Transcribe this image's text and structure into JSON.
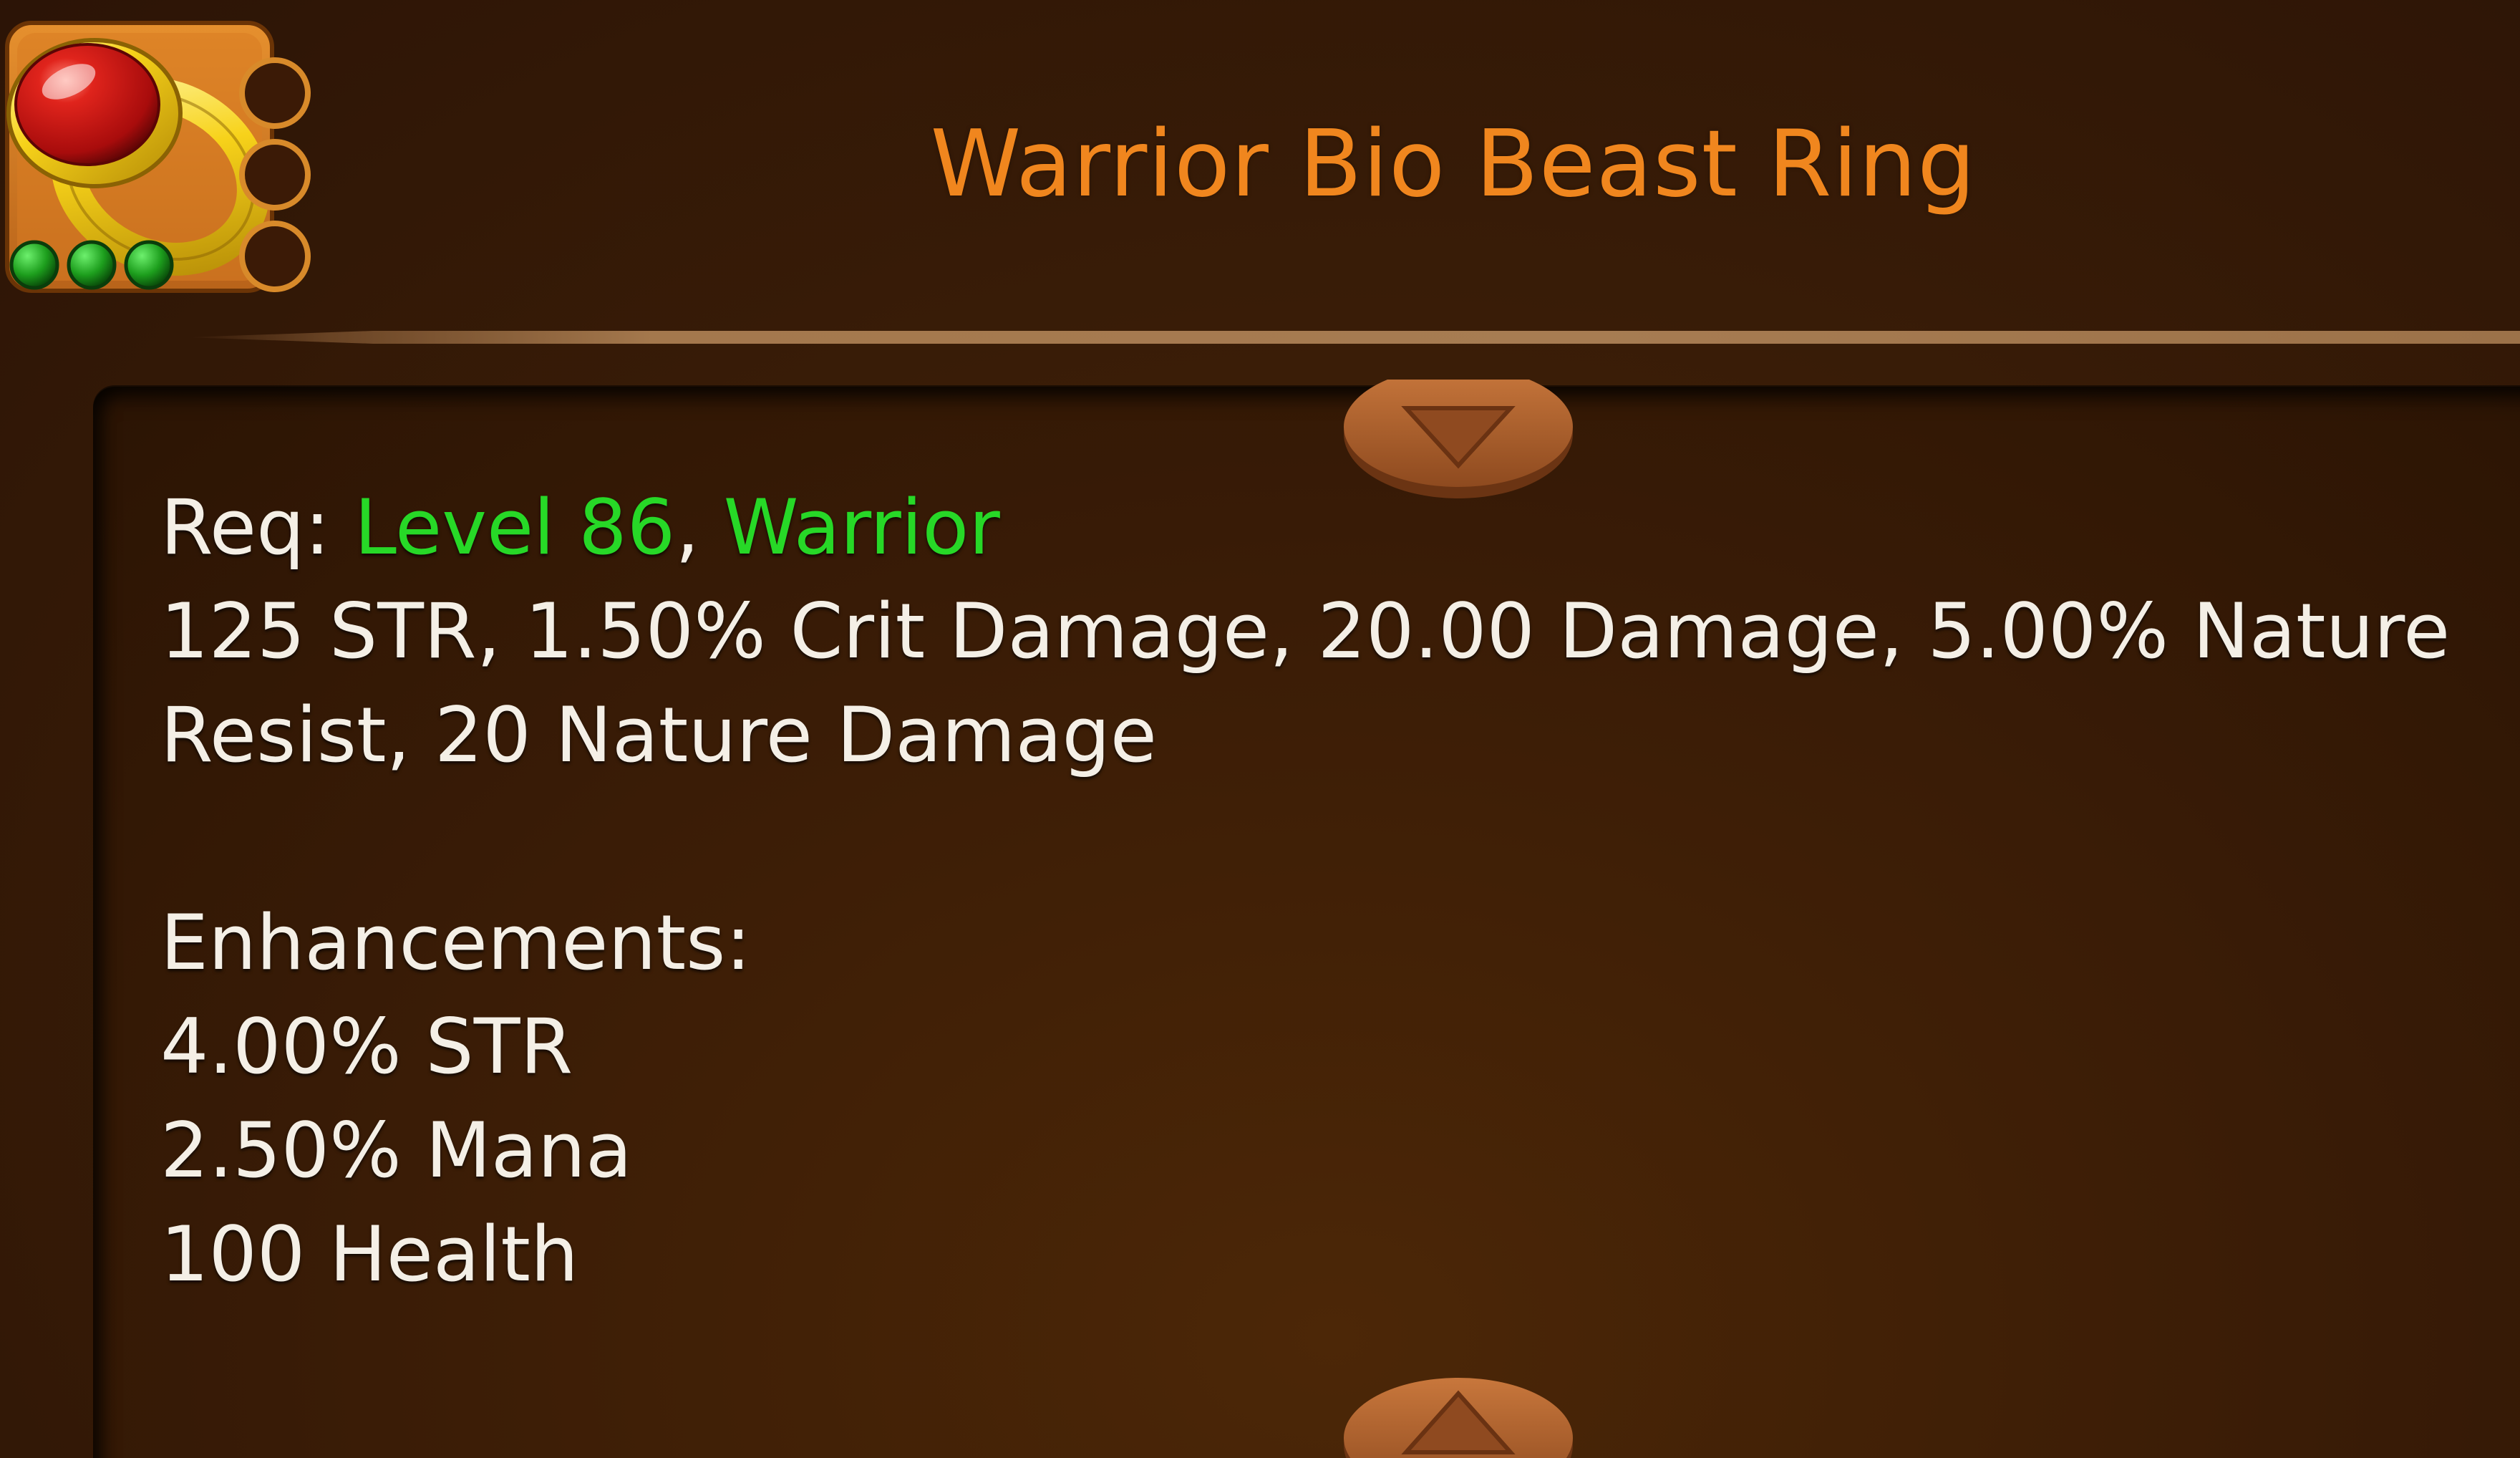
{
  "item": {
    "name": "Warrior Bio Beast Ring",
    "icon": "ruby-ring-icon",
    "enhancement_gems_filled": 3,
    "socket_slots": 3
  },
  "colors": {
    "title": "#f0861e",
    "requirement_highlight": "#27d827",
    "body_text": "#f4efe6",
    "panel_background": "#3a1c06"
  },
  "requirements": {
    "label": "Req:",
    "level": "Level 86",
    "separator": ",",
    "class": "Warrior"
  },
  "stats": {
    "line1": "125 STR, 1.50% Crit Damage, 20.00 Damage, 5.00% Nature",
    "line2": "Resist, 20 Nature Damage"
  },
  "enhancements": {
    "header": "Enhancements:",
    "items": [
      "4.00% STR",
      "2.50% Mana",
      "100 Health"
    ]
  },
  "controls": {
    "scroll_up_icon": "triangle-up-icon",
    "scroll_down_icon": "triangle-down-icon"
  }
}
